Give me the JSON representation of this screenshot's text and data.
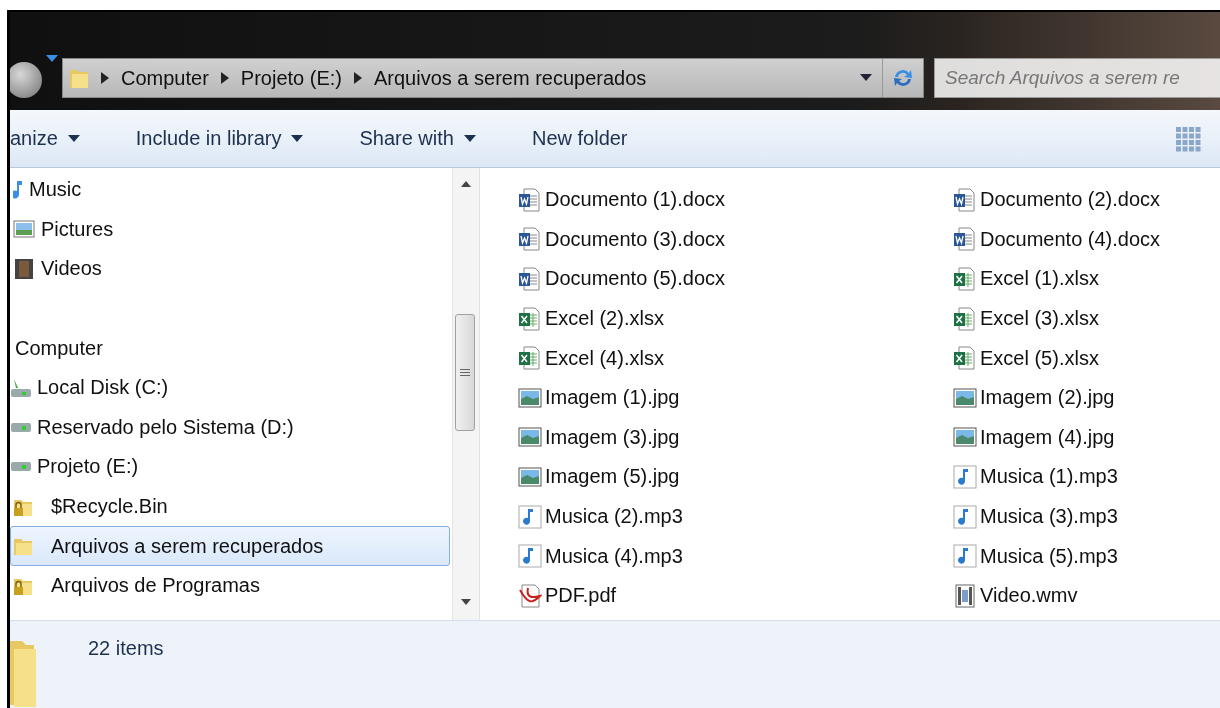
{
  "address_bar": {
    "crumbs": [
      "Computer",
      "Projeto (E:)",
      "Arquivos a serem recuperados"
    ]
  },
  "search": {
    "placeholder": "Search Arquivos a serem re"
  },
  "toolbar": [
    {
      "label": "anize",
      "menu": true
    },
    {
      "label": "Include in library",
      "menu": true
    },
    {
      "label": "Share with",
      "menu": true
    },
    {
      "label": "New folder",
      "menu": false
    }
  ],
  "nav_items": [
    {
      "label": "Music",
      "kind": "music",
      "selected": false
    },
    {
      "label": "Pictures",
      "kind": "pictures",
      "selected": false
    },
    {
      "label": "Videos",
      "kind": "videos",
      "selected": false
    },
    {
      "label": "Computer",
      "kind": "computer",
      "selected": false,
      "children": [
        {
          "label": "Local Disk (C:)",
          "kind": "system-drive",
          "selected": false
        },
        {
          "label": "Reservado pelo Sistema (D:)",
          "kind": "drive",
          "selected": false
        },
        {
          "label": "Projeto (E:)",
          "kind": "drive",
          "selected": false,
          "children": [
            {
              "label": "$Recycle.Bin",
              "kind": "locked-folder",
              "selected": false
            },
            {
              "label": "Arquivos a serem recuperados",
              "kind": "folder",
              "selected": true
            },
            {
              "label": "Arquivos de Programas",
              "kind": "locked-folder",
              "selected": false
            }
          ]
        }
      ]
    }
  ],
  "files": [
    {
      "name": "Documento (1).docx",
      "kind": "word"
    },
    {
      "name": "Documento (2).docx",
      "kind": "word"
    },
    {
      "name": "Documento (3).docx",
      "kind": "word"
    },
    {
      "name": "Documento (4).docx",
      "kind": "word"
    },
    {
      "name": "Documento (5).docx",
      "kind": "word"
    },
    {
      "name": "Excel (1).xlsx",
      "kind": "excel"
    },
    {
      "name": "Excel (2).xlsx",
      "kind": "excel"
    },
    {
      "name": "Excel (3).xlsx",
      "kind": "excel"
    },
    {
      "name": "Excel (4).xlsx",
      "kind": "excel"
    },
    {
      "name": "Excel (5).xlsx",
      "kind": "excel"
    },
    {
      "name": "Imagem (1).jpg",
      "kind": "image"
    },
    {
      "name": "Imagem (2).jpg",
      "kind": "image"
    },
    {
      "name": "Imagem (3).jpg",
      "kind": "image"
    },
    {
      "name": "Imagem (4).jpg",
      "kind": "image"
    },
    {
      "name": "Imagem (5).jpg",
      "kind": "image"
    },
    {
      "name": "Musica (1).mp3",
      "kind": "music"
    },
    {
      "name": "Musica (2).mp3",
      "kind": "music"
    },
    {
      "name": "Musica (3).mp3",
      "kind": "music"
    },
    {
      "name": "Musica (4).mp3",
      "kind": "music"
    },
    {
      "name": "Musica (5).mp3",
      "kind": "music"
    },
    {
      "name": "PDF.pdf",
      "kind": "pdf"
    },
    {
      "name": "Video.wmv",
      "kind": "video"
    }
  ],
  "status_bar": {
    "count": "22 items"
  }
}
